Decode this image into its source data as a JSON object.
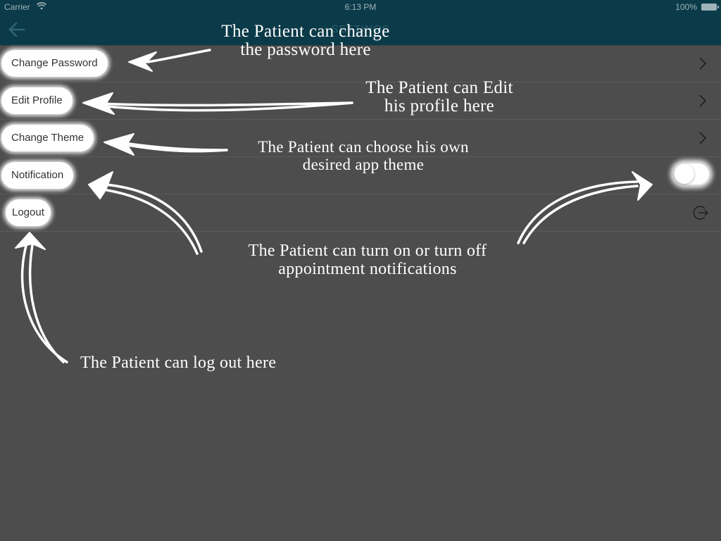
{
  "status_bar": {
    "carrier": "Carrier",
    "time": "6:13 PM",
    "battery": "100%"
  },
  "nav_bar": {
    "title": "SETTINGS",
    "back_icon": "arrow-left-icon"
  },
  "settings": {
    "items": [
      {
        "label": "Change Password",
        "accessory": "chevron-right-icon"
      },
      {
        "label": "Edit Profile",
        "accessory": "chevron-right-icon"
      },
      {
        "label": "Change Theme",
        "accessory": "chevron-right-icon"
      },
      {
        "label": "Notification",
        "accessory": "toggle-switch",
        "toggle_on": false
      },
      {
        "label": "Logout",
        "accessory": "logout-icon"
      }
    ]
  },
  "annotations": {
    "change_password_line1": "The Patient can change",
    "change_password_line2": "the password here",
    "edit_profile_line1": "The Patient can Edit",
    "edit_profile_line2": "his profile here",
    "change_theme_line1": "The Patient can choose his own",
    "change_theme_line2": "desired app theme",
    "notification_line1": "The Patient can turn on or turn off",
    "notification_line2": "appointment notifications",
    "logout_line1": "The Patient can log out here"
  },
  "colors": {
    "header_bg": "#0b3a48",
    "page_bg": "#4d4d4d",
    "annotation": "#ffffff"
  }
}
